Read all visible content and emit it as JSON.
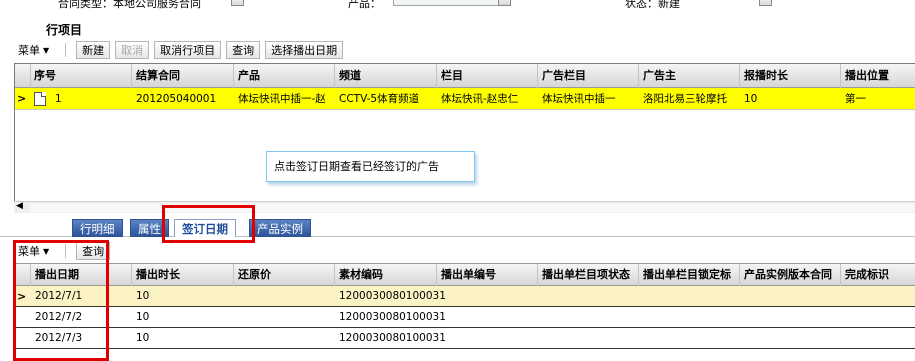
{
  "top_form": {
    "fields": [
      {
        "label": "合同类型：本地公司服务合同"
      },
      {
        "label": "产品："
      },
      {
        "label": "状态：新建"
      }
    ]
  },
  "section_title": "行项目",
  "toolbar_top": {
    "menu_label": "菜单",
    "buttons": {
      "new": "新建",
      "cancel": "取消",
      "cancel_item": "取消行项目",
      "query": "查询",
      "select_date": "选择播出日期"
    }
  },
  "grid_top": {
    "columns": [
      "序号",
      "结算合同",
      "产品",
      "频道",
      "栏目",
      "广告栏目",
      "广告主",
      "报播时长",
      "播出位置"
    ],
    "rows": [
      {
        "seq": "1",
        "contract": "201205040001",
        "product": "体坛快讯中插一-赵",
        "channel": "CCTV-5体育频道",
        "program": "体坛快讯-赵忠仁",
        "ad_program": "体坛快讯中插一",
        "advertiser": "洛阳北易三轮摩托",
        "duration": "10",
        "position": "第一"
      }
    ]
  },
  "tooltip": "点击签订日期查看已经签订的广告",
  "tabs": [
    "行明细",
    "属性",
    "签订日期",
    "产品实例"
  ],
  "active_tab": "签订日期",
  "toolbar_bottom": {
    "menu_label": "菜单",
    "query": "查询"
  },
  "grid_bottom": {
    "columns": [
      "播出日期",
      "播出时长",
      "还原价",
      "素材编码",
      "播出单编号",
      "播出单栏目项状态",
      "播出单栏目锁定标",
      "产品实例版本合同",
      "完成标识"
    ],
    "rows": [
      {
        "date": "2012/7/1",
        "duration": "10",
        "price": "",
        "material": "1200030080100031"
      },
      {
        "date": "2012/7/2",
        "duration": "10",
        "price": "",
        "material": "1200030080100031"
      },
      {
        "date": "2012/7/3",
        "duration": "10",
        "price": "",
        "material": "1200030080100031"
      }
    ]
  },
  "colors": {
    "highlight_row": "#ffff00",
    "selected_row_bottom": "#fcf3c5",
    "annotation_red": "#e00000",
    "tab_blue": "#2c559b"
  }
}
